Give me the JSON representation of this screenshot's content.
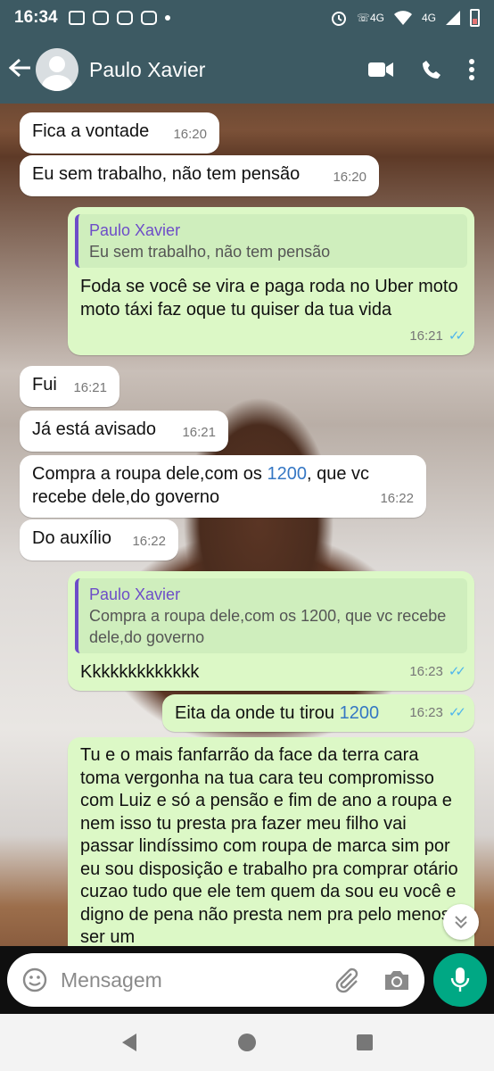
{
  "status": {
    "time": "16:34",
    "network": "4G",
    "network2": "4G"
  },
  "header": {
    "contact_name": "Paulo Xavier"
  },
  "messages": [
    {
      "dir": "in",
      "text": "Fica a vontade",
      "time": "16:20"
    },
    {
      "dir": "in",
      "text": "Eu sem trabalho, não tem pensão",
      "time": "16:20"
    },
    {
      "dir": "out",
      "quote_name": "Paulo Xavier",
      "quote_text": "Eu sem trabalho, não tem pensão",
      "text": "Foda se você se vira e paga roda no Uber moto moto táxi faz oque tu quiser da tua vida",
      "time": "16:21"
    },
    {
      "dir": "in",
      "text": "Fui",
      "time": "16:21"
    },
    {
      "dir": "in",
      "text": "Já está avisado",
      "time": "16:21"
    },
    {
      "dir": "in",
      "text_before": "Compra a roupa dele,com os ",
      "text_link": "1200",
      "text_after": ", que vc recebe dele,do governo",
      "time": "16:22"
    },
    {
      "dir": "in",
      "text": "Do auxílio",
      "time": "16:22"
    },
    {
      "dir": "out",
      "quote_name": "Paulo Xavier",
      "quote_text": "Compra a roupa dele,com os 1200, que vc recebe dele,do governo",
      "text": "Kkkkkkkkkkkkk",
      "time": "16:23"
    },
    {
      "dir": "out",
      "text_before": "Eita da onde tu tirou ",
      "text_link": "1200",
      "time": "16:23"
    },
    {
      "dir": "out",
      "text": "Tu e o mais fanfarrão da face da terra cara toma vergonha na tua cara teu compromisso com Luiz e só a pensão e fim de ano a roupa e nem isso tu presta pra fazer meu filho vai passar lindíssimo com roupa de marca sim por eu sou disposição e trabalho pra comprar otário cuzao tudo que ele tem quem da sou eu você e digno de pena não presta nem pra pelo menos ser um"
    }
  ],
  "composer": {
    "placeholder": "Mensagem"
  }
}
